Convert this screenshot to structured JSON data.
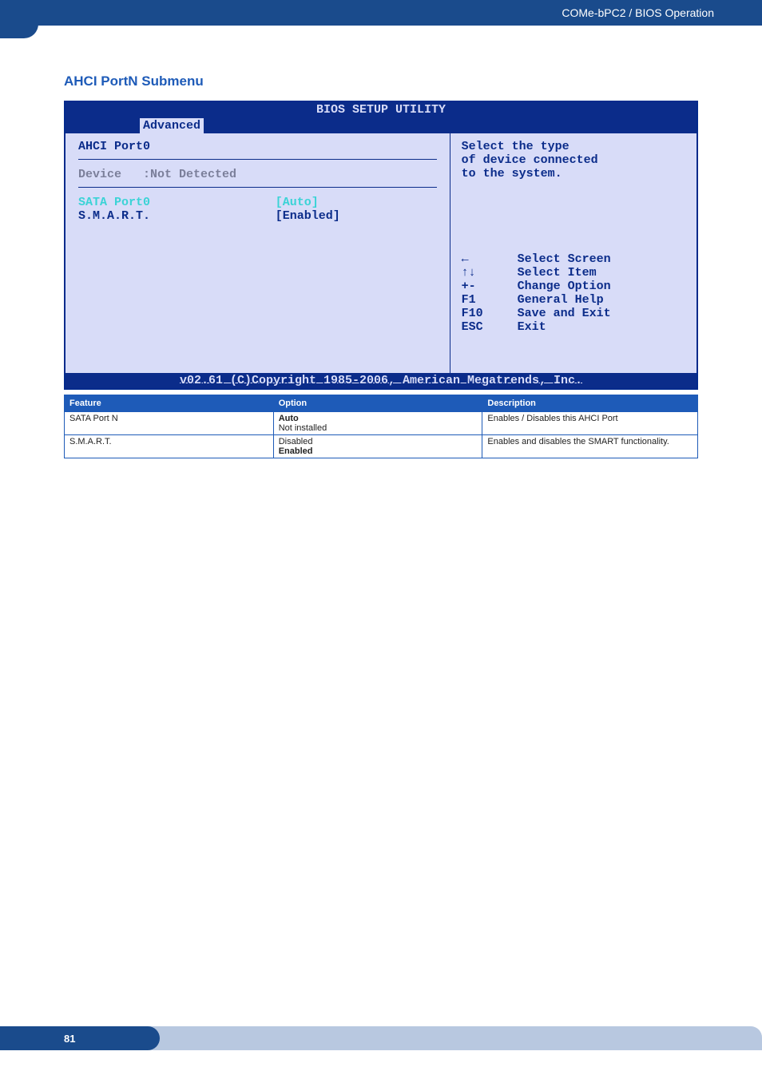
{
  "header": {
    "breadcrumb": "COMe-bPC2 / BIOS Operation"
  },
  "section": {
    "title": "AHCI PortN Submenu"
  },
  "bios": {
    "top_title": "BIOS SETUP UTILITY",
    "tab_active": "Advanced",
    "left": {
      "port_title": "AHCI Port0",
      "device_label": "Device",
      "device_value": ":Not Detected",
      "row1_label": "SATA Port0",
      "row1_value": "[Auto]",
      "row2_label": "S.M.A.R.T.",
      "row2_value": "[Enabled]"
    },
    "right": {
      "help_line1": "Select the type",
      "help_line2": "of device connected",
      "help_line3": "to the system.",
      "nav": [
        {
          "key": "←",
          "label": "Select Screen"
        },
        {
          "key": "↑↓",
          "label": "Select Item"
        },
        {
          "key": "+-",
          "label": "Change Option"
        },
        {
          "key": "F1",
          "label": "General Help"
        },
        {
          "key": "F10",
          "label": "Save and Exit"
        },
        {
          "key": "ESC",
          "label": "Exit"
        }
      ]
    },
    "copyright": "v02.61 (C)Copyright 1985-2006, American Megatrends, Inc."
  },
  "table": {
    "headers": [
      "Feature",
      "Option",
      "Description"
    ],
    "rows": [
      {
        "feature": "SATA Port N",
        "option_bold": "Auto",
        "option_plain": "Not installed",
        "description": "Enables / Disables this AHCI Port"
      },
      {
        "feature": "S.M.A.R.T.",
        "option_plain": "Disabled",
        "option_bold": "Enabled",
        "description": "Enables and disables the SMART functionality."
      }
    ]
  },
  "footer": {
    "page_number": "81"
  }
}
